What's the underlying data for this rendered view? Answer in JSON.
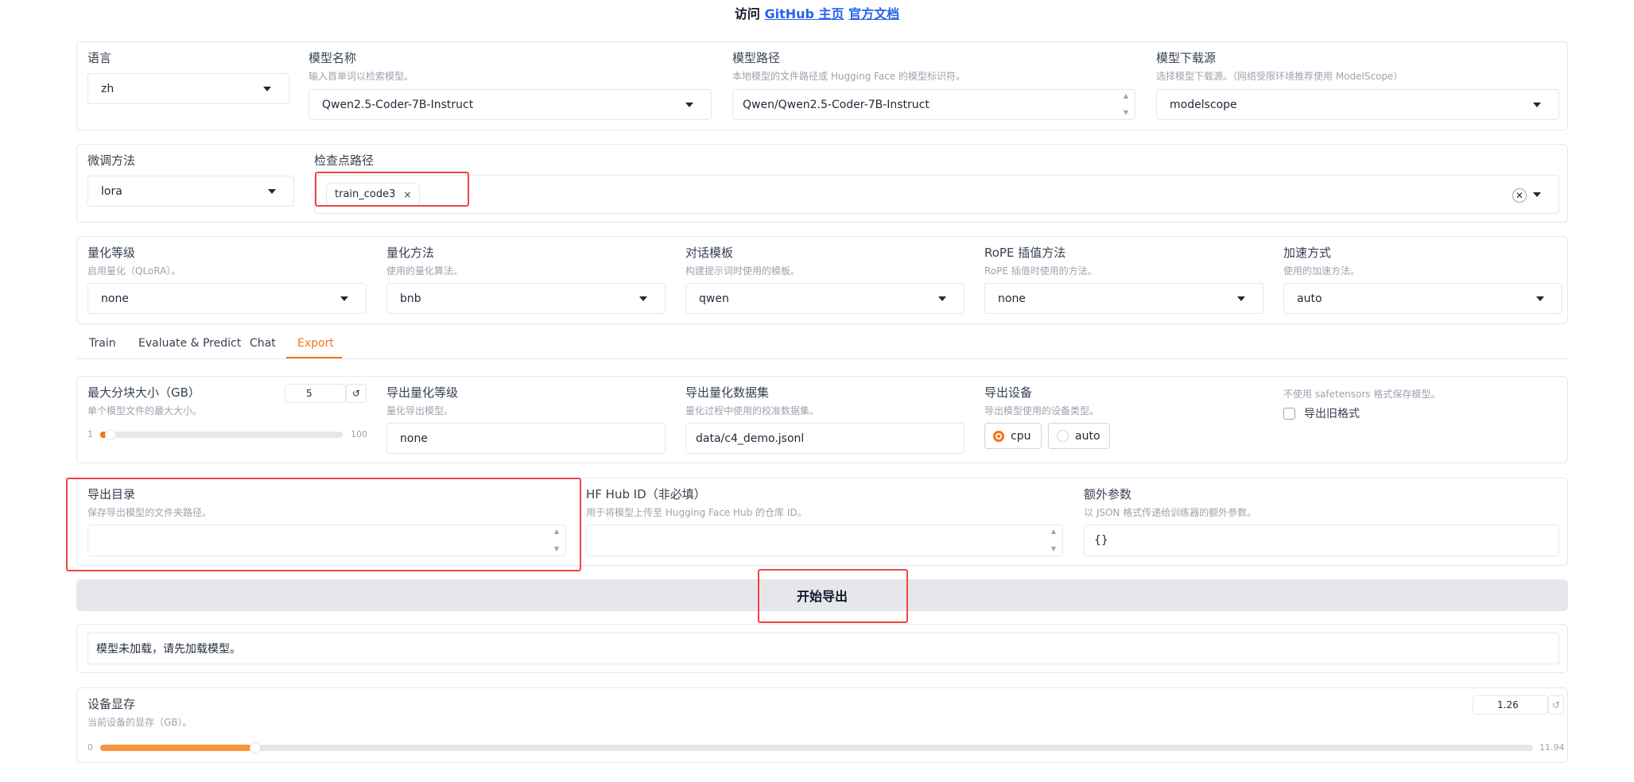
{
  "header": {
    "prefix": "访问",
    "github_link": "GitHub 主页",
    "docs_link": "官方文档"
  },
  "model_row": {
    "lang": {
      "label": "语言",
      "value": "zh"
    },
    "model_name": {
      "label": "模型名称",
      "desc": "输入首单词以检索模型。",
      "value": "Qwen2.5-Coder-7B-Instruct"
    },
    "model_path": {
      "label": "模型路径",
      "desc": "本地模型的文件路径或 Hugging Face 的模型标识符。",
      "value": "Qwen/Qwen2.5-Coder-7B-Instruct"
    },
    "hub": {
      "label": "模型下载源",
      "desc": "选择模型下载源。（网络受限环境推荐使用 ModelScope）",
      "value": "modelscope"
    }
  },
  "finetune_row": {
    "method": {
      "label": "微调方法",
      "value": "lora"
    },
    "checkpoint": {
      "label": "检查点路径",
      "tag": "train_code3",
      "tag_close": "×",
      "clear": "✕"
    }
  },
  "quant_row": {
    "quant_bit": {
      "label": "量化等级",
      "desc": "启用量化（QLoRA）。",
      "value": "none"
    },
    "quant_method": {
      "label": "量化方法",
      "desc": "使用的量化算法。",
      "value": "bnb"
    },
    "template": {
      "label": "对话模板",
      "desc": "构建提示词时使用的模板。",
      "value": "qwen"
    },
    "rope": {
      "label": "RoPE 插值方法",
      "desc": "RoPE 插值时使用的方法。",
      "value": "none"
    },
    "booster": {
      "label": "加速方式",
      "desc": "使用的加速方法。",
      "value": "auto"
    }
  },
  "tabs": [
    {
      "label": "Train",
      "active": false
    },
    {
      "label": "Evaluate & Predict",
      "active": false
    },
    {
      "label": "Chat",
      "active": false
    },
    {
      "label": "Export",
      "active": true
    }
  ],
  "export": {
    "max_shard": {
      "label": "最大分块大小（GB）",
      "desc": "单个模型文件的最大大小。",
      "value": "5",
      "min": "1",
      "max": "100",
      "reset": "↺"
    },
    "export_quant": {
      "label": "导出量化等级",
      "desc": "量化导出模型。",
      "value": "none"
    },
    "quant_dataset": {
      "label": "导出量化数据集",
      "desc": "量化过程中使用的校准数据集。",
      "value": "data/c4_demo.jsonl"
    },
    "device": {
      "label": "导出设备",
      "desc": "导出模型使用的设备类型。",
      "options": [
        "cpu",
        "auto"
      ],
      "selected": "cpu"
    },
    "legacy": {
      "desc": "不使用 safetensors 格式保存模型。",
      "label": "导出旧格式"
    },
    "export_dir": {
      "label": "导出目录",
      "desc": "保存导出模型的文件夹路径。",
      "value": ""
    },
    "hub_id": {
      "label": "HF Hub ID（非必填）",
      "desc": "用于将模型上传至 Hugging Face Hub 的仓库 ID。",
      "value": ""
    },
    "extra_args": {
      "label": "额外参数",
      "desc": "以 JSON 格式传递给训练器的额外参数。",
      "value": "{}"
    },
    "start_button": "开始导出",
    "output": "模型未加载，请先加载模型。"
  },
  "memory": {
    "label": "设备显存",
    "desc": "当前设备的显存（GB）。",
    "value": "1.26",
    "min": "0",
    "max": "11.94",
    "reset": "↺",
    "fraction": 0.1055
  },
  "colors": {
    "accent": "#f97316",
    "link": "#2563eb",
    "highlight": "#ef4444",
    "button_bg": "#e5e7eb"
  }
}
